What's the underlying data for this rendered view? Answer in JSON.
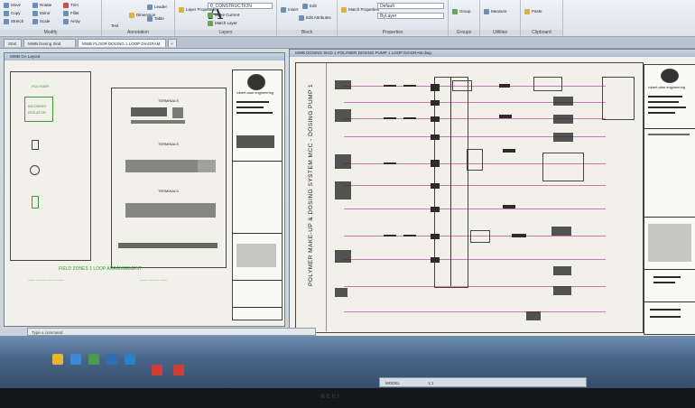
{
  "ribbon": {
    "draw_tools": [
      "Move",
      "Rotate",
      "Copy",
      "Mirror",
      "Stretch",
      "Scale",
      "Trim",
      "Fillet",
      "Array"
    ],
    "text_tool": "Text",
    "dimension_tool": "Dimension",
    "leader_tool": "Leader",
    "table_tool": "Table",
    "layer_properties": "Layer Properties",
    "layer_name": "0_CONSTRUCTION",
    "make_current": "Make Current",
    "match_layer": "Match Layer",
    "insert": "Insert",
    "edit": "Edit",
    "edit_attributes": "Edit Attributes",
    "match_properties": "Match Properties",
    "prop_combo1": "Default",
    "prop_combo2": "ByLayer",
    "group": "Group",
    "measure": "Measure",
    "paste": "Paste",
    "group_labels": [
      "Modify",
      "Annotation",
      "Layers",
      "Block",
      "Properties",
      "Groups",
      "Utilities",
      "Clipboard"
    ]
  },
  "doc_tabs": [
    "Start",
    "MWB Dosing Skid",
    "MWB FLOOR DOSING 1 LOOP DIAGRAM"
  ],
  "window_left": {
    "title": "MWB GA Layout",
    "green_labels": [
      "POLYMER",
      "INCOMING",
      "ISOLATOR"
    ],
    "panel_labels": [
      "TERMINALS",
      "TERMINALS",
      "TERMINALS"
    ],
    "footer_green": "FIELD ZONES 1 LOOP ARRANGEMENT",
    "logo_text": "robert alan engineering"
  },
  "window_right": {
    "title": "MWB DOSING SKID 1 POLYMER DOSING PUMP 1 LOOP DIAGRAM.dwg",
    "vertical_title": "POLYMER MAKE-UP & DOSING SYSTEM MCC - DOSING PUMP 1",
    "logo_text": "robert alan engineering"
  },
  "command_line": "Type a command",
  "status": {
    "coords": "MODEL",
    "scale": "1:1"
  },
  "monitor_brand": "acer"
}
